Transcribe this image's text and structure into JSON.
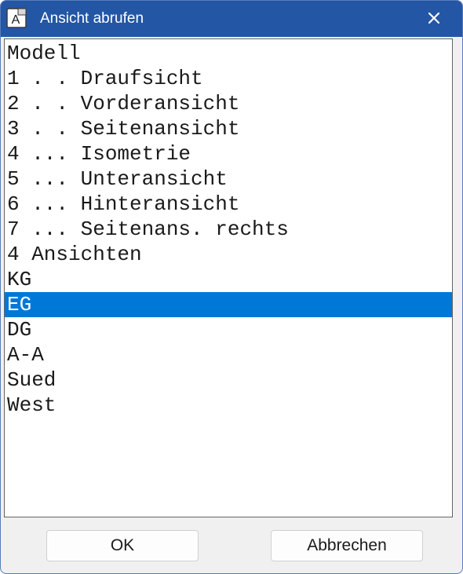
{
  "window": {
    "title": "Ansicht abrufen",
    "app_icon_letter": "A",
    "close_glyph": "✕",
    "colors": {
      "titlebar": "#2356a5",
      "selection": "#0078d7",
      "dialog_background": "#f0f0f0"
    }
  },
  "list": {
    "selected_index": 10,
    "items": [
      {
        "label": "Modell"
      },
      {
        "label": "1 . . Draufsicht"
      },
      {
        "label": "2 . . Vorderansicht"
      },
      {
        "label": "3 . . Seitenansicht"
      },
      {
        "label": "4 ... Isometrie"
      },
      {
        "label": "5 ... Unteransicht"
      },
      {
        "label": "6 ... Hinteransicht"
      },
      {
        "label": "7 ... Seitenans. rechts"
      },
      {
        "label": "4 Ansichten"
      },
      {
        "label": "KG"
      },
      {
        "label": "EG"
      },
      {
        "label": "DG"
      },
      {
        "label": "A-A"
      },
      {
        "label": "Sued"
      },
      {
        "label": "West"
      }
    ]
  },
  "buttons": {
    "ok_label": "OK",
    "cancel_label": "Abbrechen"
  }
}
